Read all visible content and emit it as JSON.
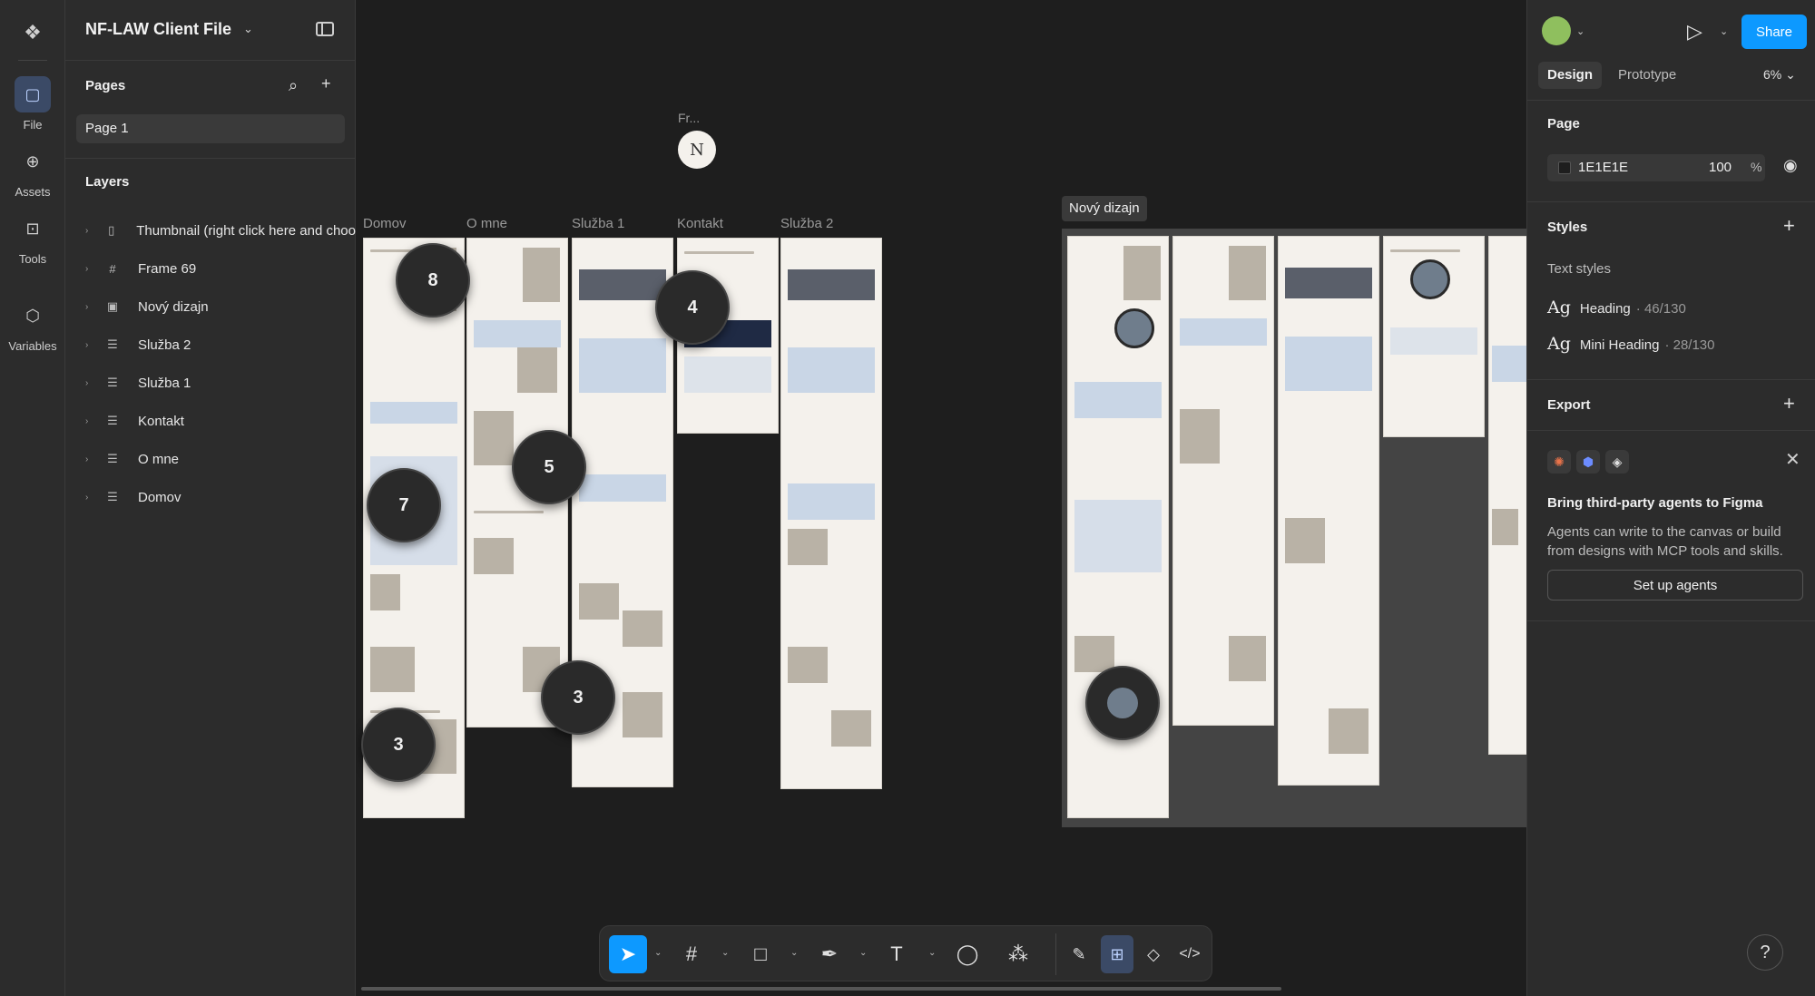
{
  "rail": {
    "items": [
      {
        "label": "File",
        "icon": "file-icon"
      },
      {
        "label": "Assets",
        "icon": "assets-icon"
      },
      {
        "label": "Tools",
        "icon": "tools-icon"
      },
      {
        "label": "Variables",
        "icon": "variables-icon"
      }
    ]
  },
  "file": {
    "title": "NF-LAW Client File"
  },
  "pages": {
    "heading": "Pages",
    "items": [
      "Page 1"
    ]
  },
  "layers": {
    "heading": "Layers",
    "items": [
      {
        "label": "Thumbnail (right click here and choo",
        "icon": "thumbnail-icon"
      },
      {
        "label": "Frame 69",
        "icon": "frame-icon"
      },
      {
        "label": "Nový dizajn",
        "icon": "section-icon"
      },
      {
        "label": "Služba 2",
        "icon": "frame-layout-icon"
      },
      {
        "label": "Služba 1",
        "icon": "frame-layout-icon"
      },
      {
        "label": "Kontakt",
        "icon": "frame-layout-icon"
      },
      {
        "label": "O mne",
        "icon": "frame-layout-icon"
      },
      {
        "label": "Domov",
        "icon": "frame-layout-icon"
      }
    ]
  },
  "canvas": {
    "fr_label": "Fr...",
    "fr_logo": "N",
    "frame_labels": [
      "Domov",
      "O mne",
      "Služba 1",
      "Kontakt",
      "Služba 2"
    ],
    "group_label": "Nový dizajn",
    "badges": [
      "8",
      "4",
      "5",
      "7",
      "3",
      "3"
    ]
  },
  "toolbar": {
    "tools": [
      "move-tool",
      "frame-tool",
      "shape-tool",
      "pen-tool",
      "text-tool",
      "comment-tool",
      "actions-tool",
      "draw-mode",
      "design-mode",
      "dev-component-mode",
      "dev-mode"
    ]
  },
  "right": {
    "share_label": "Share",
    "tabs": [
      "Design",
      "Prototype"
    ],
    "zoom": "6%",
    "page": {
      "heading": "Page",
      "hex": "1E1E1E",
      "opacity": "100",
      "pct": "%"
    },
    "styles": {
      "heading": "Styles",
      "sub": "Text styles",
      "items": [
        {
          "name": "Heading",
          "meta": "· 46/130"
        },
        {
          "name": "Mini Heading",
          "meta": "· 28/130"
        }
      ]
    },
    "export": {
      "heading": "Export"
    },
    "promo": {
      "title": "Bring third-party agents to Figma",
      "body": "Agents can write to the canvas or build from designs with MCP tools and skills.",
      "button": "Set up agents"
    },
    "help": "?"
  },
  "colors": {
    "accent": "#0d99ff",
    "canvas": "#1e1e1e",
    "panel": "#2c2c2c"
  }
}
